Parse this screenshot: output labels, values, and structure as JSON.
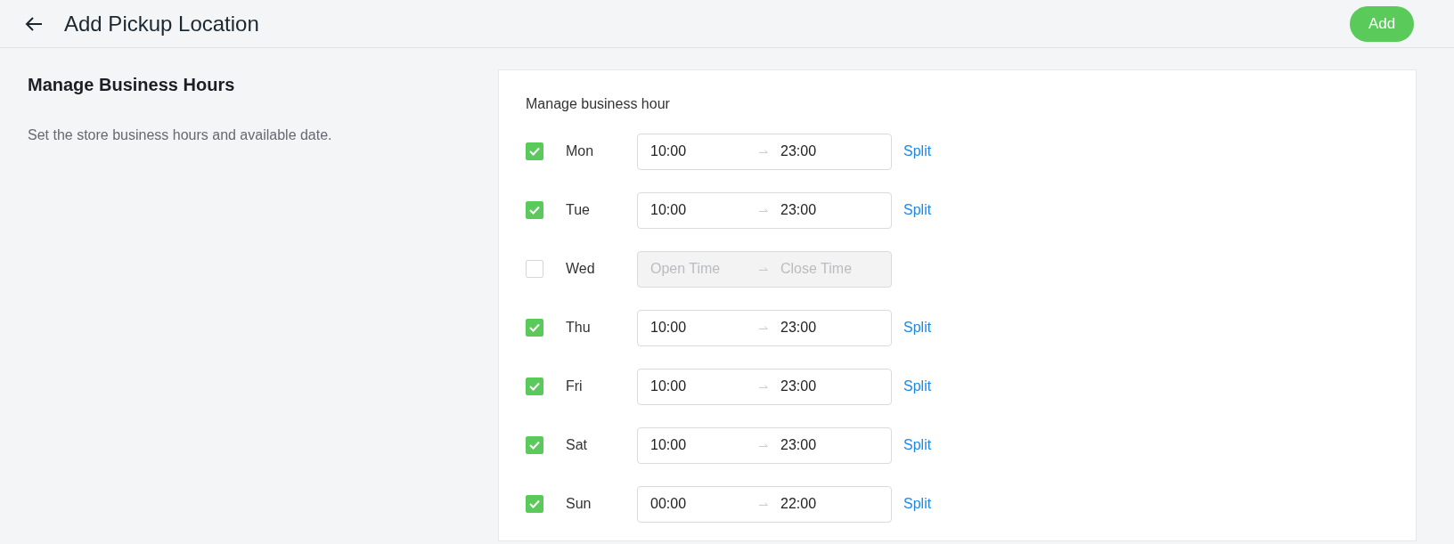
{
  "header": {
    "title": "Add Pickup Location",
    "add_button": "Add"
  },
  "section": {
    "title": "Manage Business Hours",
    "description": "Set the store business hours and available date."
  },
  "card": {
    "label": "Manage business hour",
    "days": [
      {
        "day": "Mon",
        "checked": true,
        "open": "10:00",
        "close": "23:00",
        "split": "Split"
      },
      {
        "day": "Tue",
        "checked": true,
        "open": "10:00",
        "close": "23:00",
        "split": "Split"
      },
      {
        "day": "Wed",
        "checked": false,
        "open_placeholder": "Open Time",
        "close_placeholder": "Close Time"
      },
      {
        "day": "Thu",
        "checked": true,
        "open": "10:00",
        "close": "23:00",
        "split": "Split"
      },
      {
        "day": "Fri",
        "checked": true,
        "open": "10:00",
        "close": "23:00",
        "split": "Split"
      },
      {
        "day": "Sat",
        "checked": true,
        "open": "10:00",
        "close": "23:00",
        "split": "Split"
      },
      {
        "day": "Sun",
        "checked": true,
        "open": "00:00",
        "close": "22:00",
        "split": "Split"
      }
    ]
  }
}
